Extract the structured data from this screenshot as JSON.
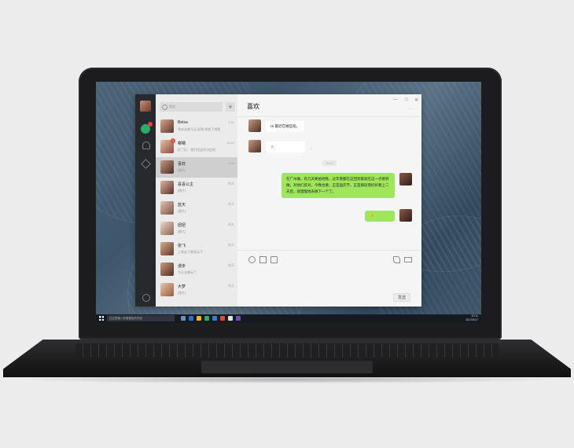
{
  "wechat": {
    "search_placeholder": "搜索",
    "add_label": "+",
    "chats": [
      {
        "name": "Betsa",
        "preview": "周末去哪儿玩 好啊 那就了吧嗯",
        "time": "9:51",
        "badge": ""
      },
      {
        "name": "唧唧",
        "preview": "好了好，我们也这样决定吧",
        "time": "12:30",
        "badge": "1"
      },
      {
        "name": "喜欢",
        "preview": "[图片]",
        "time": "9:45",
        "badge": ""
      },
      {
        "name": "喜喜公主",
        "preview": "[图片]",
        "time": "昨天",
        "badge": ""
      },
      {
        "name": "蓝天",
        "preview": "[图片]",
        "time": "昨天",
        "badge": ""
      },
      {
        "name": "妞妞",
        "preview": "[图片]",
        "time": "昨天",
        "badge": ""
      },
      {
        "name": "张飞",
        "preview": "上周去了哪里玩了",
        "time": "昨天",
        "badge": ""
      },
      {
        "name": "漫步",
        "preview": "今天去哪玩了",
        "time": "昨天",
        "badge": ""
      },
      {
        "name": "大梦",
        "preview": "[图片]",
        "time": "昨天",
        "badge": ""
      }
    ],
    "conversation": {
      "title": "喜欢",
      "controls": [
        "—",
        "□",
        "✕"
      ],
      "more": "···",
      "messages": [
        {
          "dir": "in",
          "text": "Hi 最近在做些啥。"
        },
        {
          "dir": "in",
          "text": "☺"
        },
        {
          "dir": "out",
          "text": "在广州做，有几天要拍地铁，过年我都在这回到家就在这一点要到做。对他们反对，今晚也要，正是国庆节，正是那段落好好看上二天后，就慢慢地去做下一个了。"
        },
        {
          "dir": "out",
          "text": "👍"
        }
      ],
      "time_tag": "10:10",
      "read_tag": "1",
      "send_label": "发送"
    }
  },
  "taskbar": {
    "search_text": "在这里输入你要搜索的内容",
    "time": "10:11",
    "date": "2017/5/17"
  }
}
